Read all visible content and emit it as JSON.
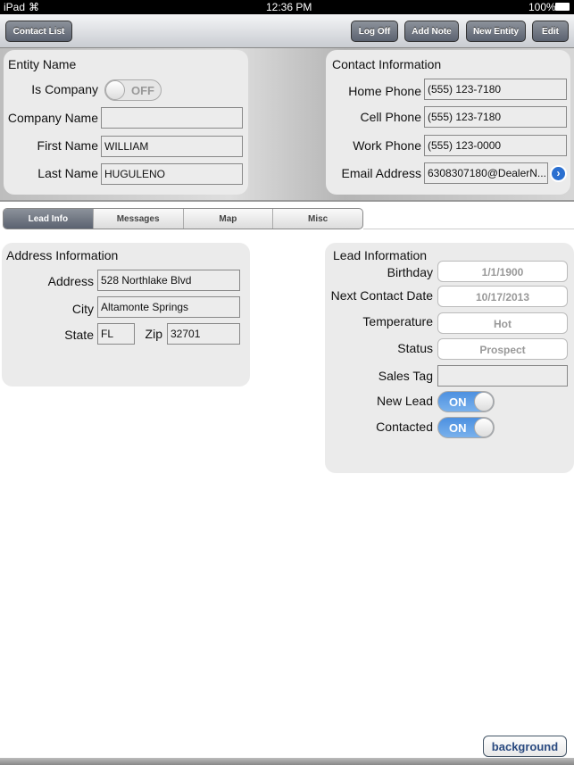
{
  "status_bar": {
    "device": "iPad",
    "time": "12:36 PM",
    "battery": "100%"
  },
  "toolbar": {
    "contact_list": "Contact List",
    "log_off": "Log Off",
    "add_note": "Add Note",
    "new_entity": "New Entity",
    "edit": "Edit"
  },
  "entity": {
    "title": "Entity Name",
    "is_company_label": "Is Company",
    "is_company_state": "OFF",
    "company_name_label": "Company Name",
    "company_name": "",
    "first_name_label": "First Name",
    "first_name": "WILLIAM",
    "last_name_label": "Last Name",
    "last_name": "HUGULENO"
  },
  "contact": {
    "title": "Contact Information",
    "home_label": "Home Phone",
    "home": "(555) 123-7180",
    "cell_label": "Cell Phone",
    "cell": "(555) 123-7180",
    "work_label": "Work Phone",
    "work": "(555) 123-0000",
    "email_label": "Email Address",
    "email": "6308307180@DealerN..."
  },
  "tabs": [
    {
      "label": "Lead Info",
      "active": true
    },
    {
      "label": "Messages"
    },
    {
      "label": "Map"
    },
    {
      "label": "Misc"
    }
  ],
  "address": {
    "title": "Address Information",
    "address_label": "Address",
    "address": "528 Northlake Blvd",
    "city_label": "City",
    "city": "Altamonte Springs",
    "state_label": "State",
    "state": "FL",
    "zip_label": "Zip",
    "zip": "32701"
  },
  "lead": {
    "title": "Lead Information",
    "birthday_label": "Birthday",
    "birthday": "1/1/1900",
    "next_label": "Next Contact Date",
    "next": "10/17/2013",
    "temp_label": "Temperature",
    "temp": "Hot",
    "status_label": "Status",
    "status": "Prospect",
    "sales_tag_label": "Sales Tag",
    "sales_tag": "",
    "new_lead_label": "New Lead",
    "new_lead_state": "ON",
    "contacted_label": "Contacted",
    "contacted_state": "ON"
  },
  "background_button": "background",
  "colors": {
    "toggle_on": "#4d90e0",
    "toolbar_button": "#5b6270",
    "detail_button": "#2a6fd0"
  }
}
